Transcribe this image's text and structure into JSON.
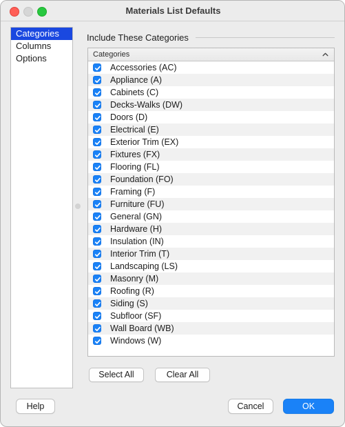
{
  "window": {
    "title": "Materials List Defaults",
    "traffic_lights": [
      {
        "name": "close",
        "color": "#ff5f57"
      },
      {
        "name": "minimize",
        "color": "#d6d6d6"
      },
      {
        "name": "zoom",
        "color": "#28c840"
      }
    ]
  },
  "sidebar": {
    "items": [
      {
        "label": "Categories",
        "selected": true
      },
      {
        "label": "Columns",
        "selected": false
      },
      {
        "label": "Options",
        "selected": false
      }
    ],
    "selected_color": "#1a48e0"
  },
  "main": {
    "group_label": "Include These Categories",
    "table": {
      "column_header": "Categories",
      "sort_icon": "chevron-up-icon",
      "rows": [
        {
          "label": "Accessories (AC)",
          "checked": true
        },
        {
          "label": "Appliance (A)",
          "checked": true
        },
        {
          "label": "Cabinets (C)",
          "checked": true
        },
        {
          "label": "Decks-Walks (DW)",
          "checked": true
        },
        {
          "label": "Doors (D)",
          "checked": true
        },
        {
          "label": "Electrical (E)",
          "checked": true
        },
        {
          "label": "Exterior Trim (EX)",
          "checked": true
        },
        {
          "label": "Fixtures (FX)",
          "checked": true
        },
        {
          "label": "Flooring (FL)",
          "checked": true
        },
        {
          "label": "Foundation (FO)",
          "checked": true
        },
        {
          "label": "Framing (F)",
          "checked": true
        },
        {
          "label": "Furniture (FU)",
          "checked": true
        },
        {
          "label": "General (GN)",
          "checked": true
        },
        {
          "label": "Hardware (H)",
          "checked": true
        },
        {
          "label": "Insulation (IN)",
          "checked": true
        },
        {
          "label": "Interior Trim (T)",
          "checked": true
        },
        {
          "label": "Landscaping (LS)",
          "checked": true
        },
        {
          "label": "Masonry (M)",
          "checked": true
        },
        {
          "label": "Roofing (R)",
          "checked": true
        },
        {
          "label": "Siding (S)",
          "checked": true
        },
        {
          "label": "Subfloor (SF)",
          "checked": true
        },
        {
          "label": "Wall Board (WB)",
          "checked": true
        },
        {
          "label": "Windows (W)",
          "checked": true
        }
      ]
    },
    "select_all_label": "Select All",
    "clear_all_label": "Clear All"
  },
  "footer": {
    "help_label": "Help",
    "cancel_label": "Cancel",
    "ok_label": "OK",
    "ok_color": "#1a82f7"
  }
}
